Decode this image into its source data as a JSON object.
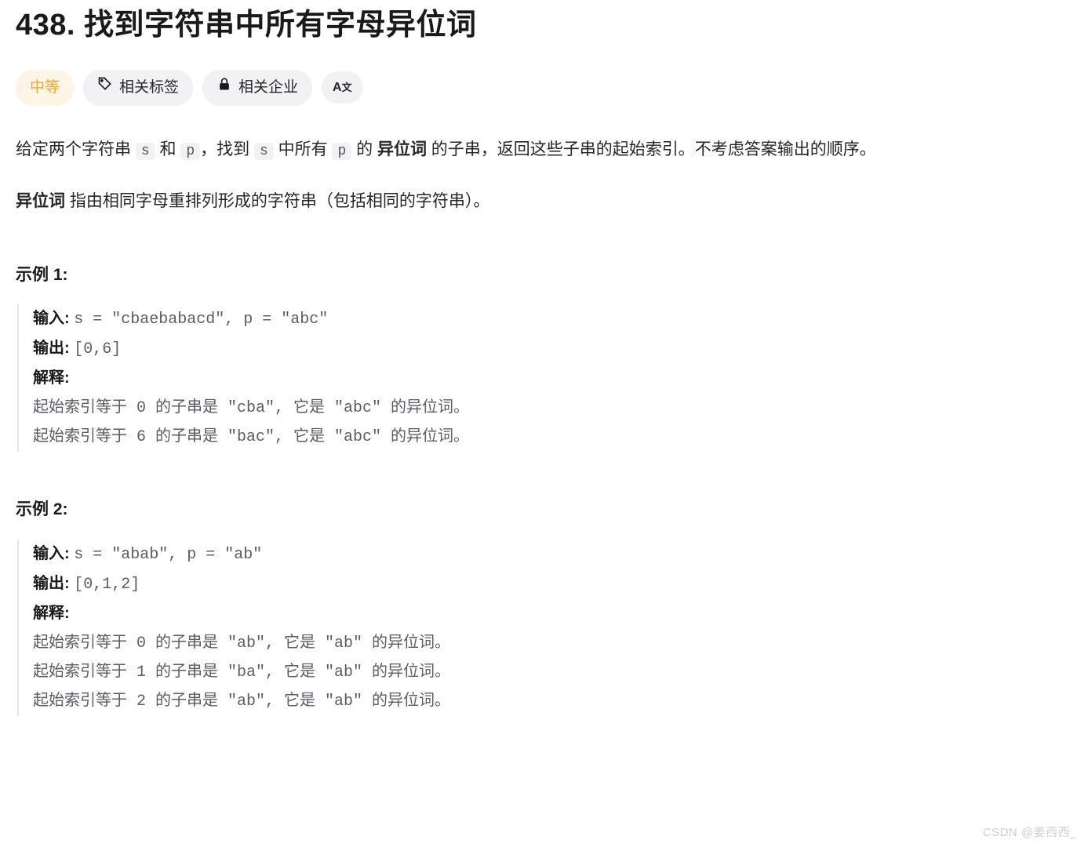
{
  "title_number": "438.",
  "title_text": "找到字符串中所有字母异位词",
  "badges": {
    "difficulty": "中等",
    "tags": "相关标签",
    "companies": "相关企业",
    "translate_icon": "Aあ"
  },
  "description": {
    "p1_a": "给定两个字符串 ",
    "p1_code1": "s",
    "p1_b": " 和 ",
    "p1_code2": "p",
    "p1_c": "，找到 ",
    "p1_code3": "s",
    "p1_d": " 中所有 ",
    "p1_code4": "p",
    "p1_e": " 的 ",
    "p1_bold": "异位词",
    "p1_f": " 的子串，返回这些子串的起始索引。不考虑答案输出的顺序。",
    "p2_bold": "异位词 ",
    "p2_text": "指由相同字母重排列形成的字符串（包括相同的字符串）。"
  },
  "examples": [
    {
      "heading": "示例 1:",
      "input_label": "输入: ",
      "input_value": "s = \"cbaebabacd\", p = \"abc\"",
      "output_label": "输出: ",
      "output_value": "[0,6]",
      "explain_label": "解释:",
      "explain_lines": [
        "起始索引等于 0 的子串是 \"cba\", 它是 \"abc\" 的异位词。",
        "起始索引等于 6 的子串是 \"bac\", 它是 \"abc\" 的异位词。"
      ]
    },
    {
      "heading": " 示例 2:",
      "input_label": "输入: ",
      "input_value": "s = \"abab\", p = \"ab\"",
      "output_label": "输出: ",
      "output_value": "[0,1,2]",
      "explain_label": "解释:",
      "explain_lines": [
        "起始索引等于 0 的子串是 \"ab\", 它是 \"ab\" 的异位词。",
        "起始索引等于 1 的子串是 \"ba\", 它是 \"ab\" 的异位词。",
        "起始索引等于 2 的子串是 \"ab\", 它是 \"ab\" 的异位词。"
      ]
    }
  ],
  "watermark": "CSDN @姜西西_"
}
